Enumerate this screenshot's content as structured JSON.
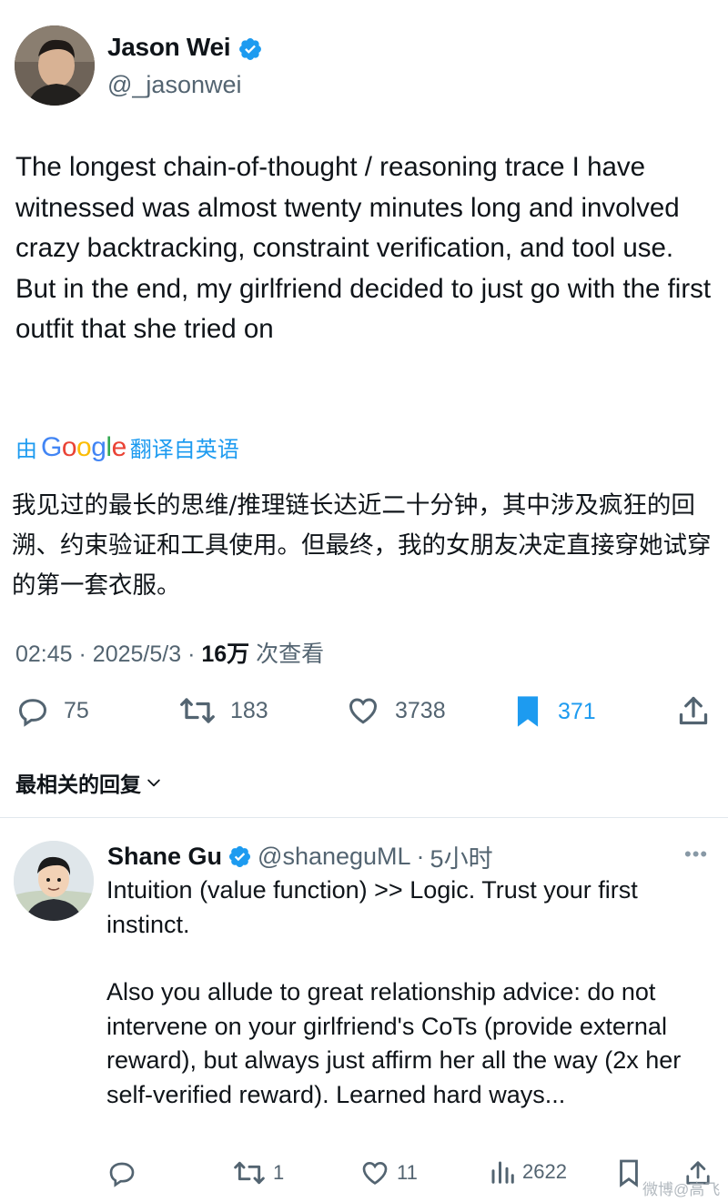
{
  "author": {
    "name": "Jason Wei",
    "handle": "@_jasonwei",
    "verified": true
  },
  "tweet": {
    "text": "The longest chain-of-thought / reasoning trace I have witnessed was almost twenty minutes long and involved crazy backtracking, constraint verification, and tool use. But in the end, my girlfriend decided to just go with the first outfit that she tried on",
    "translate_prefix": "由",
    "translate_brand": "Google",
    "translate_suffix": "翻译自英语",
    "translated_text": "我见过的最长的思维/推理链长达近二十分钟，其中涉及疯狂的回溯、约束验证和工具使用。但最终，我的女朋友决定直接穿她试穿的第一套衣服。",
    "time": "02:45",
    "date": "2025/5/3",
    "views": "16万",
    "views_label": "次查看",
    "sep": "·"
  },
  "actions": {
    "replies": "75",
    "retweets": "183",
    "likes": "3738",
    "bookmarks": "371"
  },
  "relevant_replies_label": "最相关的回复",
  "reply": {
    "name": "Shane Gu",
    "handle": "@shaneguML",
    "sep": "·",
    "time": "5小时",
    "more": "•••",
    "paragraph1": "Intuition (value function) >> Logic. Trust your first instinct.",
    "paragraph2": "Also you allude to great relationship advice: do not intervene on your girlfriend's CoTs (provide external reward), but always just affirm her all the way (2x her self-verified reward). Learned hard ways...",
    "actions": {
      "replies": "",
      "retweets": "1",
      "likes": "11",
      "views": "2622"
    }
  },
  "watermark": "微博@高飞",
  "colors": {
    "accent": "#1d9bf0",
    "muted": "#536471",
    "text": "#0f1419",
    "google_blue": "#4285F4",
    "google_red": "#EA4335",
    "google_yellow": "#FBBC05",
    "google_green": "#34A853"
  }
}
